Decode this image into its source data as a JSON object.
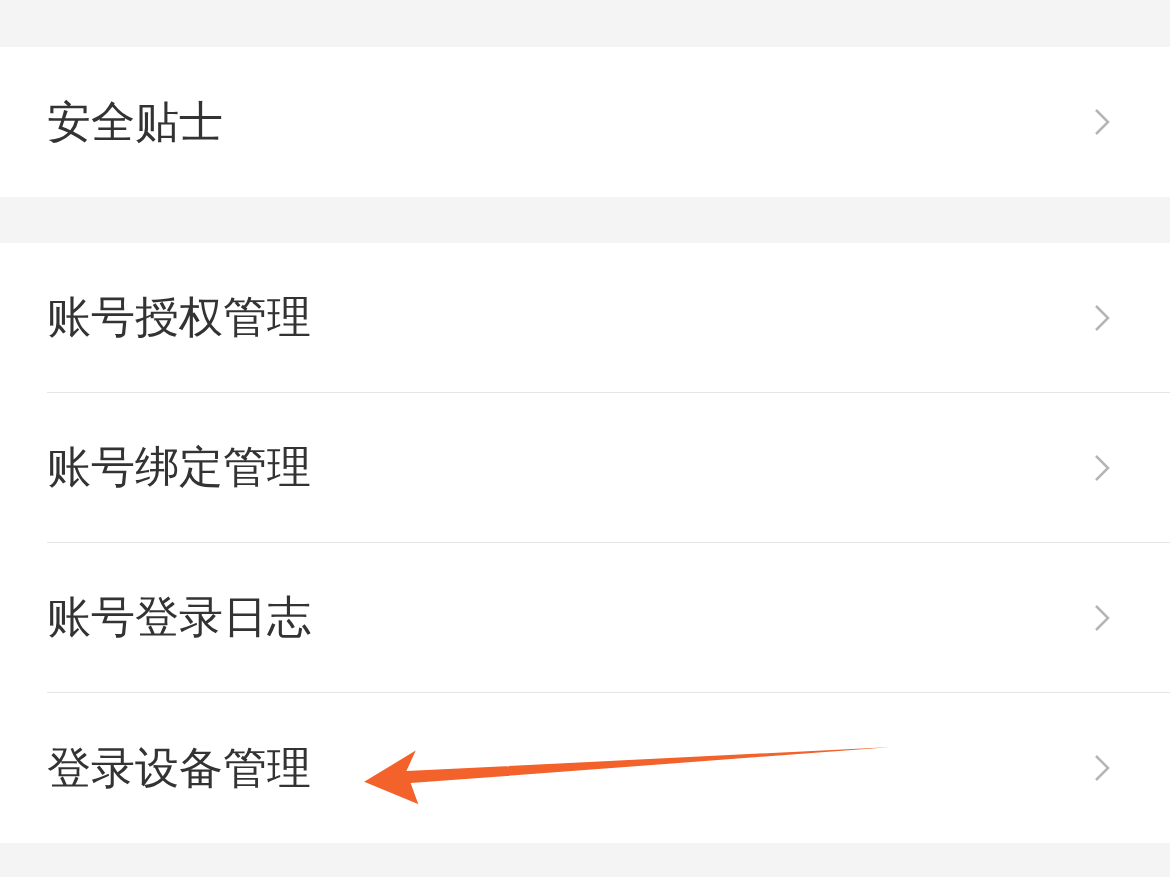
{
  "groups": [
    {
      "items": [
        {
          "label": "安全贴士"
        }
      ]
    },
    {
      "items": [
        {
          "label": "账号授权管理"
        },
        {
          "label": "账号绑定管理"
        },
        {
          "label": "账号登录日志"
        },
        {
          "label": "登录设备管理"
        }
      ]
    }
  ]
}
